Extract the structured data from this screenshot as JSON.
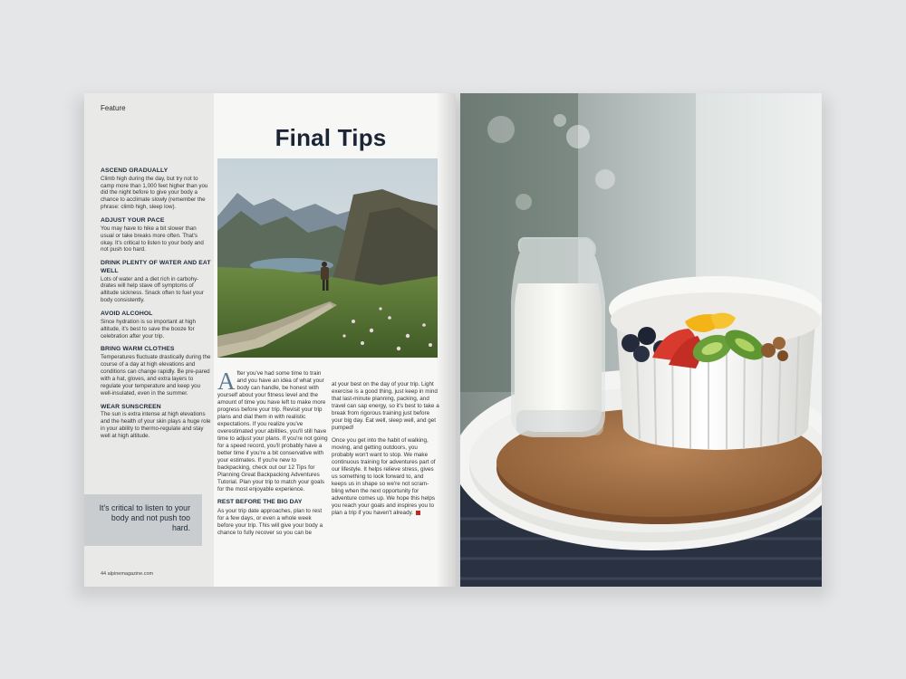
{
  "left_page": {
    "section_label": "Feature",
    "title": "Final Tips",
    "sidebar_tips": [
      {
        "heading": "ASCEND GRADUALLY",
        "body": "Climb high during the day, but try not to camp more than 1,000 feet higher than you did the night before to give your body a chance to acclimate slowly (remember the phrase: climb high, sleep low)."
      },
      {
        "heading": "ADJUST YOUR PACE",
        "body": "You may have to hike a bit slower than usual or take breaks more often. That's okay. It's critical to listen to your body and not push too hard."
      },
      {
        "heading": "DRINK PLENTY OF WATER AND EAT WELL",
        "body": "Lots of water and a diet rich in carbohy-drates will help stave off symptoms of altitude sickness. Snack often to fuel your body consistently."
      },
      {
        "heading": "AVOID ALCOHOL",
        "body": "Since hydration is so important at high altitude, it's best to save the booze for celebration after your trip."
      },
      {
        "heading": "BRING WARM CLOTHES",
        "body": "Temperatures fluctuate drastically during the course of a day at high elevations and conditions can change rapidly. Be pre-pared with a hat, gloves, and extra layers to regulate your temperature and keep you well-insulated, even in the summer."
      },
      {
        "heading": "WEAR SUNSCREEN",
        "body": "The sun is extra intense at high elevations and the health of your skin plays a huge role in your ability to thermo-regulate and stay well at high altitude."
      }
    ],
    "pull_quote": "It's critical to listen to your body and not push too hard.",
    "page_number": "44  alpinemagazine.com",
    "dropcap": "A",
    "col1_p1": "fter you've had some time to train and you have an idea of what your body can handle, be honest with yourself about your fitness level and the amount of time you have left to make more progress before your trip. Revisit your trip plans and dial them in with realistic expectations. If you realize you've overestimated your abilities, you'll still have time to adjust your plans. If you're not going for a speed record, you'll probably have a better time if you're a bit conservative with your estimates. If you're new to backpacking, check out our 12 Tips for Planning Great Backpacking Adventures Tutorial. Plan your trip to match your goals for the most enjoyable experience.",
    "subhead": "REST BEFORE THE BIG DAY",
    "col1_p2": "As your trip date approaches, plan to rest for a few days, or even a whole week before your trip. This will give your body a chance to fully recover so you can be",
    "col2_p1": "at your best on the day of your trip. Light exercise is a good thing, just keep in mind that last-minute planning, packing, and travel can sap energy, so it's best to take a break from rigorous training just before your big day. Eat well, sleep well, and get pumped!",
    "col2_p2": "Once you get into the habit of walking, moving, and getting outdoors, you probably won't want to stop. We make continuous training for adventures part of our lifestyle. It helps relieve stress, gives us something to look forward to, and keeps us in shape so we're not scram-bling when the next opportunity for adventure comes up. We hope this helps you reach your goals and inspires you to plan a trip if you haven't already."
  },
  "colors": {
    "title_navy": "#1b2536",
    "dropcap_blue": "#5a7a92",
    "pullquote_bg": "#c9cdd0",
    "end_mark_red": "#c0272d"
  }
}
